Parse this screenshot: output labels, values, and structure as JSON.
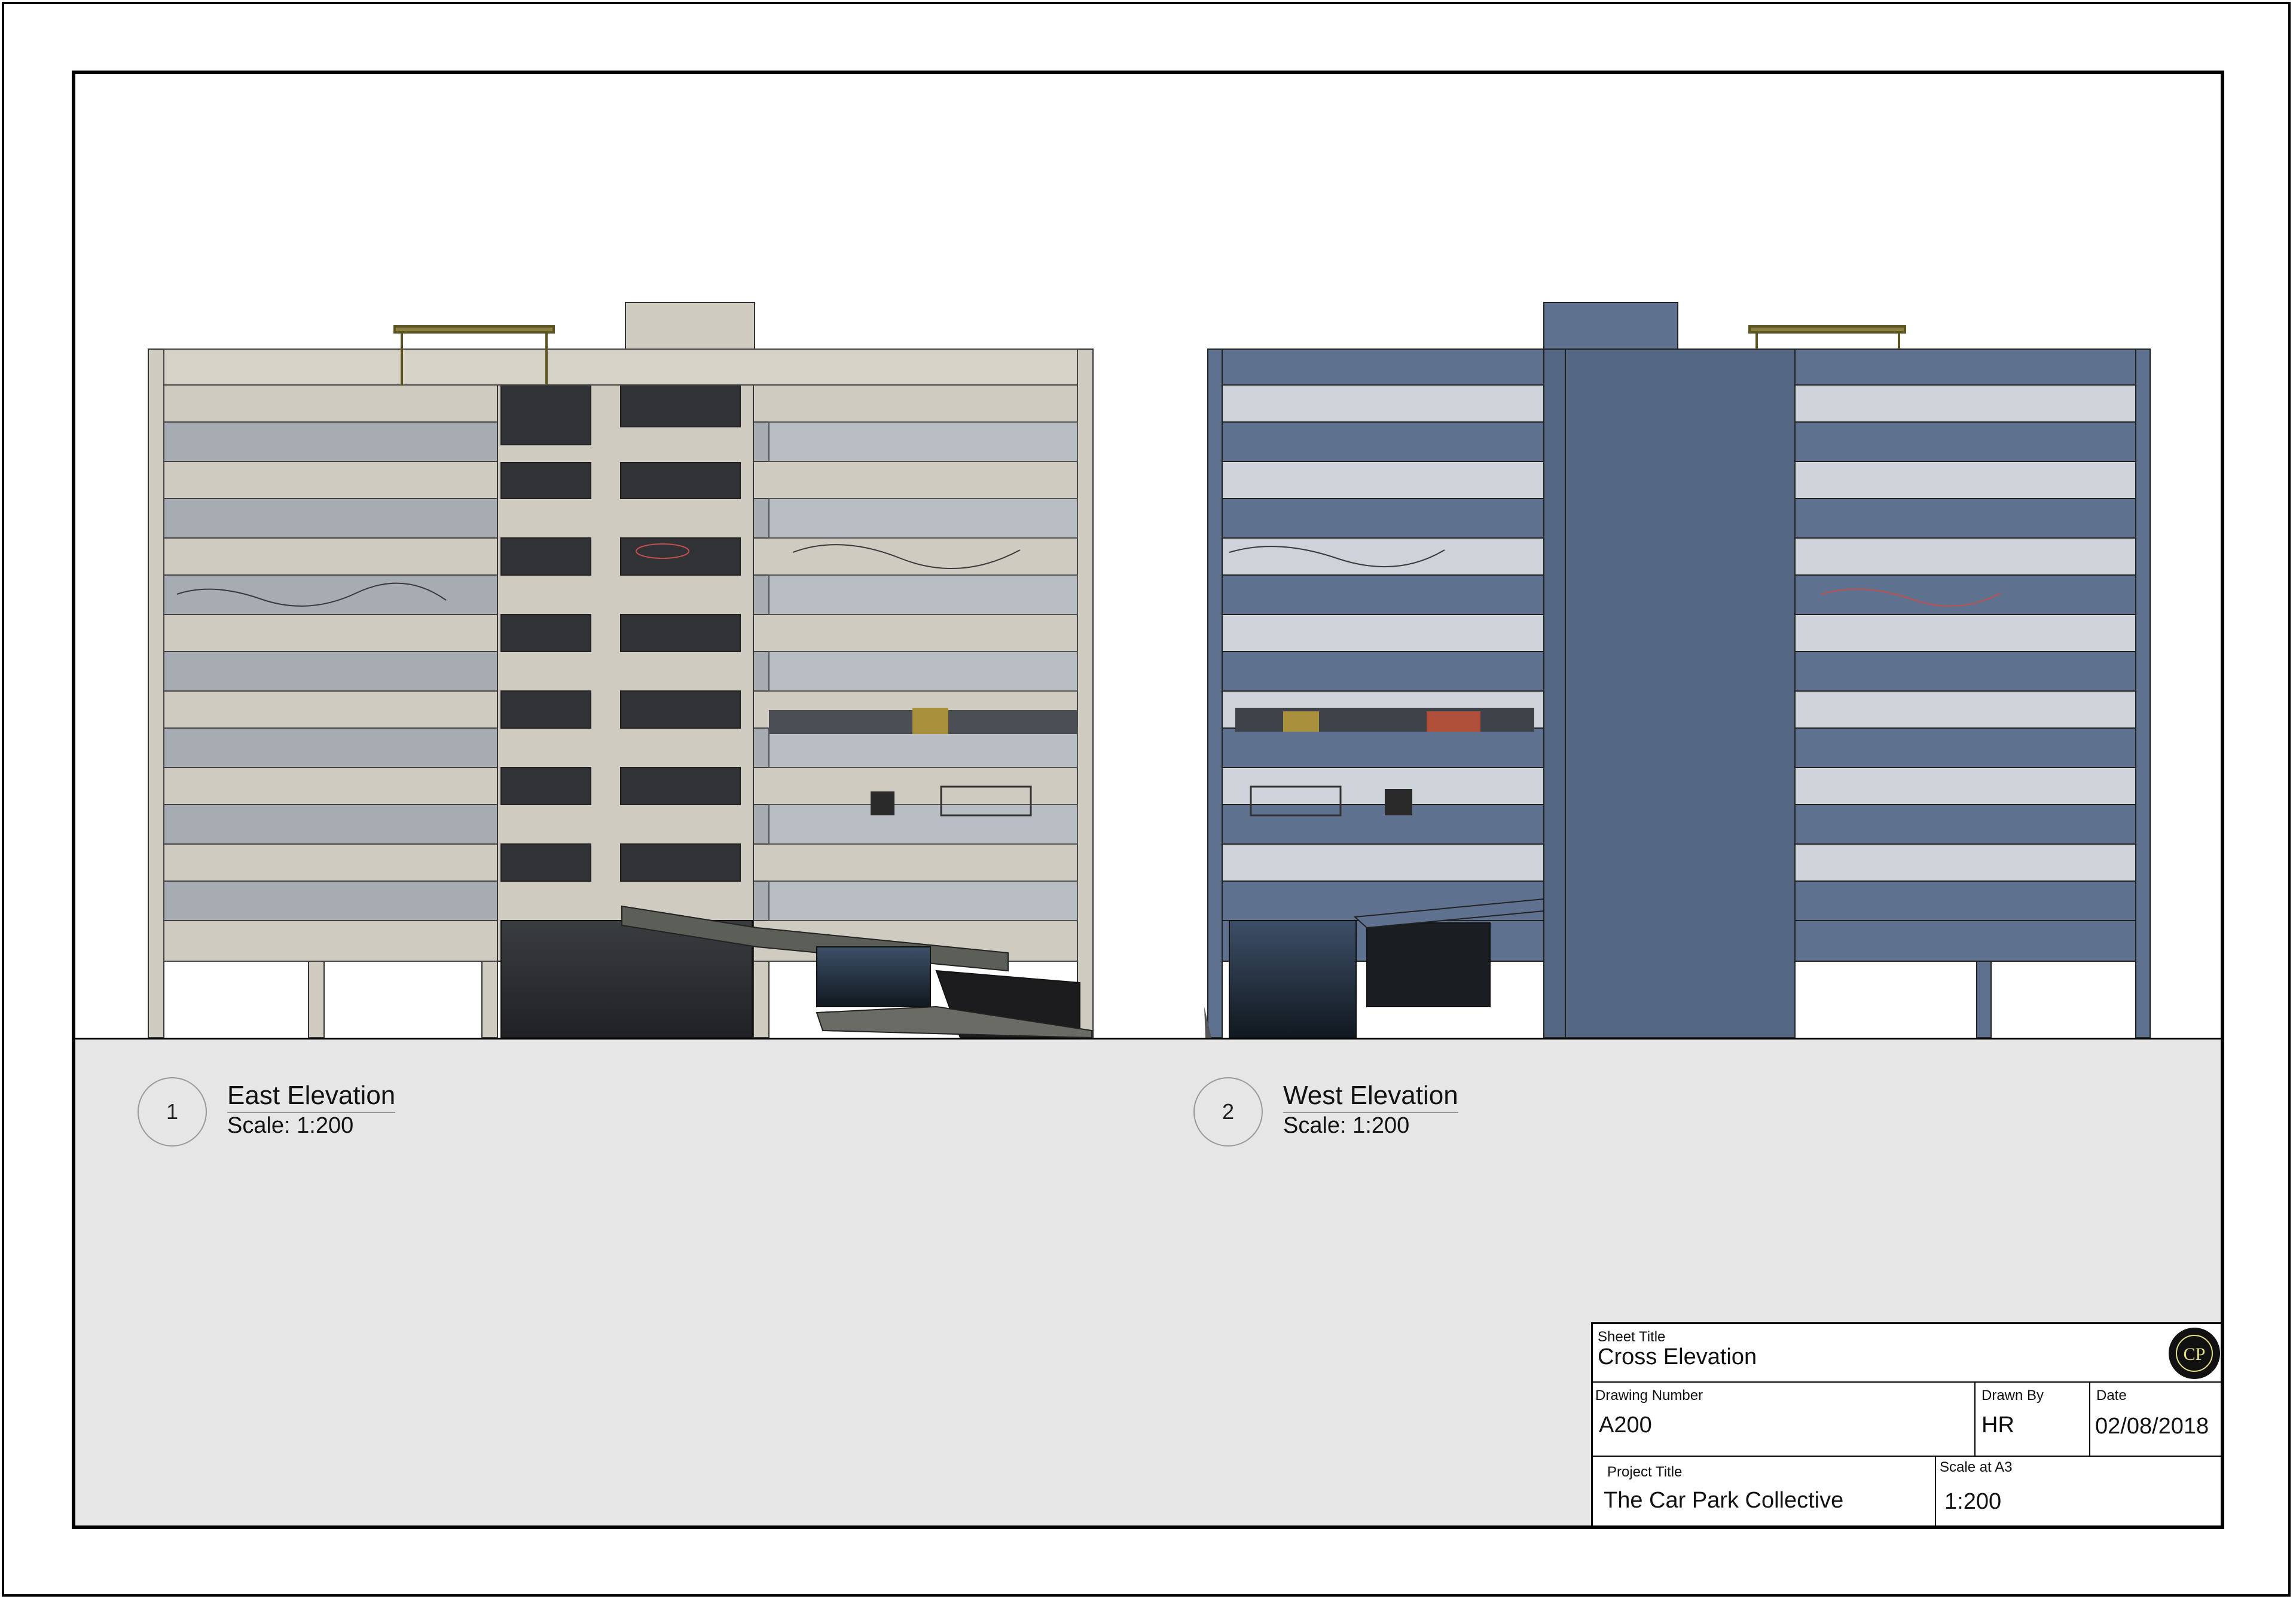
{
  "views": [
    {
      "number": "1",
      "title": "East Elevation",
      "scale": "Scale: 1:200"
    },
    {
      "number": "2",
      "title": "West Elevation",
      "scale": "Scale: 1:200"
    }
  ],
  "title_block": {
    "sheet_title_label": "Sheet Title",
    "sheet_title": "Cross Elevation",
    "drawing_number_label": "Drawing Number",
    "drawing_number": "A200",
    "drawn_by_label": "Drawn By",
    "drawn_by": "HR",
    "date_label": "Date",
    "date": "02/08/2018",
    "project_title_label": "Project Title",
    "project_title": "The Car Park Collective",
    "scale_label": "Scale at A3",
    "scale": "1:200",
    "logo_icon": "cpc-logo-icon"
  },
  "colors": {
    "concrete": "#cfcbc0",
    "blue_concrete": "#5e7290",
    "glazing_grey": "#a7acb3",
    "glazing_light": "#cdd3d8",
    "dark": "#2b2d30",
    "ground": "#e6e6e6",
    "canopy": "#8a8044"
  }
}
